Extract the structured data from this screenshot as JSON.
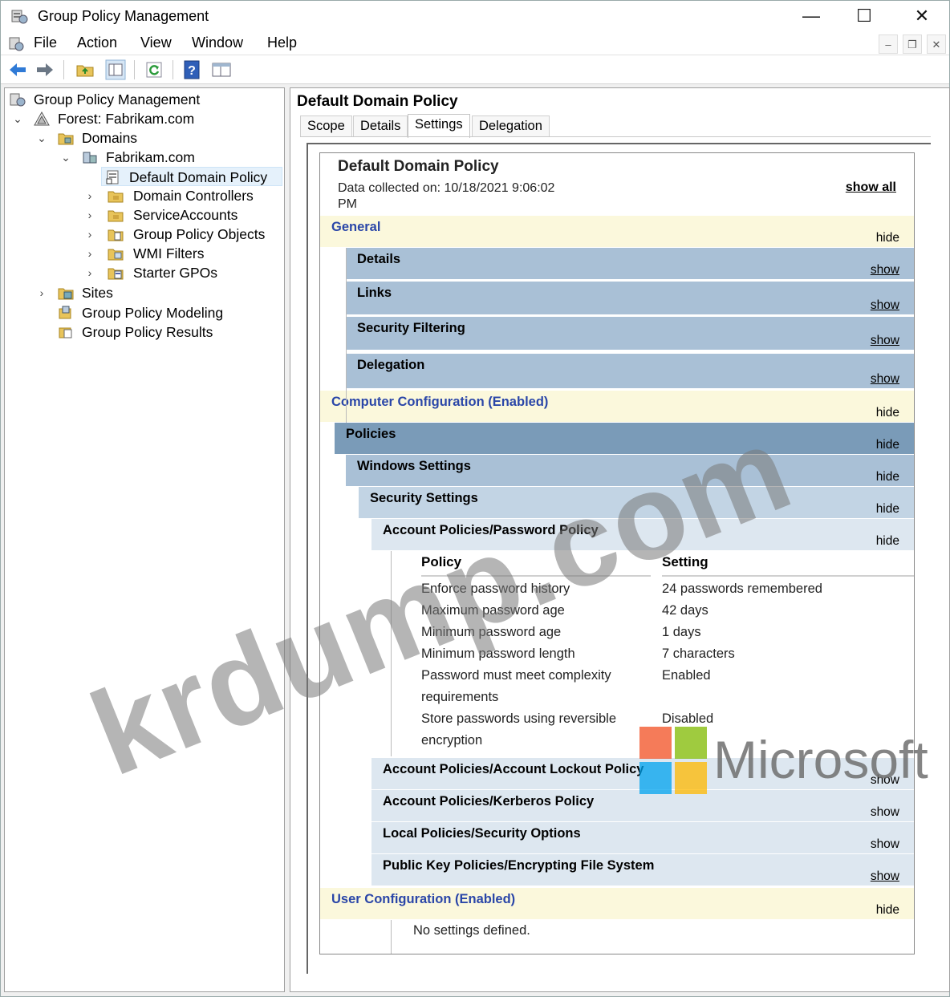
{
  "window": {
    "title": "Group Policy Management",
    "controls": {
      "minimize": "—",
      "maximize": "☐",
      "close": "✕"
    }
  },
  "menu": [
    "File",
    "Action",
    "View",
    "Window",
    "Help"
  ],
  "toolbar": [
    "back-icon",
    "forward-icon",
    "up-folder-icon",
    "show-hide-tree-icon",
    "refresh-icon",
    "help-icon",
    "properties-icon"
  ],
  "tree": {
    "root": "Group Policy Management",
    "forest": "Forest: Fabrikam.com",
    "domains": "Domains",
    "domain": "Fabrikam.com",
    "children": [
      "Default Domain Policy",
      "Domain Controllers",
      "ServiceAccounts",
      "Group Policy Objects",
      "WMI Filters",
      "Starter GPOs"
    ],
    "sites": "Sites",
    "modeling": "Group Policy Modeling",
    "results": "Group Policy Results"
  },
  "right": {
    "title": "Default Domain Policy",
    "tabs": [
      "Scope",
      "Details",
      "Settings",
      "Delegation"
    ],
    "active_tab": "Settings"
  },
  "report": {
    "title": "Default Domain Policy",
    "date_line1": "Data collected on: 10/18/2021 9:06:02",
    "date_line2": "PM",
    "show_all": "show all",
    "general": "General",
    "details": "Details",
    "links": "Links",
    "security_filtering": "Security Filtering",
    "delegation": "Delegation",
    "computer_config": "Computer Configuration (Enabled)",
    "policies": "Policies",
    "windows_settings": "Windows Settings",
    "security_settings": "Security Settings",
    "password_policy": "Account Policies/Password Policy",
    "lockout_policy": "Account Policies/Account Lockout Policy",
    "kerberos_policy": "Account Policies/Kerberos Policy",
    "local_policies": "Local Policies/Security Options",
    "pubkey_policies": "Public Key Policies/Encrypting File System",
    "user_config": "User Configuration (Enabled)",
    "no_settings": "No settings defined.",
    "hide": "hide",
    "show": "show",
    "col_policy": "Policy",
    "col_setting": "Setting",
    "rows": [
      {
        "policy": "Enforce password history",
        "setting": "24 passwords remembered"
      },
      {
        "policy": "Maximum password age",
        "setting": "42 days"
      },
      {
        "policy": "Minimum password age",
        "setting": "1 days"
      },
      {
        "policy": "Minimum password length",
        "setting": "7 characters"
      },
      {
        "policy": "Password must meet complexity",
        "policy2": "requirements",
        "setting": "Enabled"
      },
      {
        "policy": "Store passwords using reversible",
        "policy2": "encryption",
        "setting": "Disabled"
      }
    ]
  },
  "watermark": {
    "text": "krdump.com",
    "brand": "Microsoft"
  }
}
